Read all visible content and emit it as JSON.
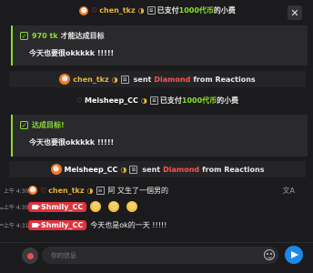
{
  "gift_notice_1": {
    "user": "chen_tkz",
    "text_pre": "已支付",
    "amount": "1000代币",
    "text_post": "的小费"
  },
  "goal_1": {
    "amount": "970 tk",
    "label": "才能达成目标",
    "message": "今天也要很okkkkk !!!!!"
  },
  "diamond_1": {
    "user": "chen_tkz",
    "text": "sent",
    "item": "Diamond",
    "source": "from Reactions"
  },
  "gift_notice_2": {
    "user": "Meisheep_CC",
    "text_pre": "已支付",
    "amount": "1000代币",
    "text_post": "的小费"
  },
  "goal_2": {
    "label": "达成目标!",
    "message": "今天也要很okkkkk !!!!!"
  },
  "diamond_2": {
    "user": "Meisheep_CC",
    "text": "sent",
    "item": "Diamond",
    "source": "from Reactions"
  },
  "chat": [
    {
      "time": "上午 4:30",
      "user": "chen_tkz",
      "message": "阿 又生了一個男的"
    },
    {
      "time": "上午 4:30",
      "user": "Shmily_CC",
      "emojis": [
        "😍",
        "😍",
        "😍"
      ]
    },
    {
      "time": "上午 4:31",
      "user": "Shmily_CC",
      "message": "今天也是ok的一天 !!!!!"
    }
  ],
  "input": {
    "placeholder": "你的信息"
  },
  "colors": {
    "accent_green": "#8bdc2e",
    "diamond_red": "#ff5252",
    "host_tag": "#e2333d",
    "send_blue": "#1e88e5"
  }
}
